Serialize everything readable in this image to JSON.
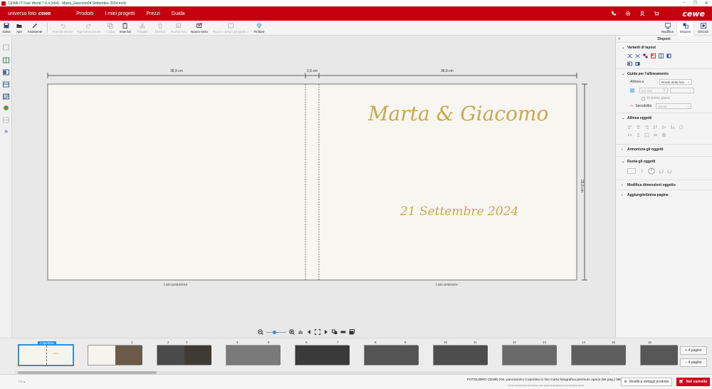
{
  "window": {
    "title": "CEWE FOTOWELT Foto World 7.4.4 (x64) - Marta_Giacomo04 Settembre 2024.mcfx",
    "title_display": "CEWE.IT Foto World 7.4.4 (x64) - Marta_Giacomo04 Settembre 2024.mcfx"
  },
  "menubar": {
    "brand_prefix": "universo foto",
    "brand_name": "cewe",
    "nav": [
      "Prodotti",
      "I miei progetti",
      "Prezzi",
      "Guida"
    ],
    "logo": "cewe"
  },
  "toolbar": {
    "items": [
      {
        "label": "Salva",
        "icon": "save-icon",
        "enabled": true
      },
      {
        "label": "Apri",
        "icon": "open-folder-icon",
        "enabled": true
      },
      {
        "label": "Assistente",
        "icon": "magic-wand-icon",
        "enabled": true
      },
      {
        "label": "Annulla azione",
        "icon": "undo-icon",
        "enabled": false
      },
      {
        "label": "Ripristina azione",
        "icon": "redo-icon",
        "enabled": false
      },
      {
        "label": "Copia",
        "icon": "copy-icon",
        "enabled": false
      },
      {
        "label": "Inserisci",
        "icon": "paste-icon",
        "enabled": true
      },
      {
        "label": "Ritaglia",
        "icon": "cut-icon",
        "enabled": false
      },
      {
        "label": "Elimina",
        "icon": "trash-icon",
        "enabled": false
      },
      {
        "label": "Nuova foto",
        "icon": "add-photo-icon",
        "enabled": false
      },
      {
        "label": "Nuovo testo",
        "icon": "add-text-icon",
        "enabled": true
      },
      {
        "label": "Nuovo campo geografico",
        "icon": "map-icon",
        "enabled": false
      },
      {
        "label": "Finiture",
        "icon": "diamond-icon",
        "enabled": true
      }
    ],
    "right": [
      {
        "label": "Modifica",
        "icon": "edit-icon"
      },
      {
        "label": "Disponi",
        "icon": "arrange-icon",
        "active": true
      },
      {
        "label": "Decora",
        "icon": "decorate-icon"
      }
    ]
  },
  "canvas": {
    "dim_back": "38,9 cm",
    "dim_spine": "2,0 cm",
    "dim_front": "38,9 cm",
    "dim_height": "29,6 cm",
    "names": "Marta & Giacomo",
    "date": "21 Settembre 2024",
    "label_back": "Lato posteriore",
    "label_front": "Lato anteriore",
    "gold": "#c9a84c"
  },
  "panel": {
    "title": "Disponi",
    "layout_variants": "Varianti di layout",
    "alignment_guide": "Guida per l'allineamento",
    "align_to_label": "Allinea a",
    "align_to_value": "Bordo della foto",
    "distance_value": "5,0 mm",
    "foreground_label": "In primo piano",
    "sensitivity_label": "Sensibilità",
    "sensitivity_value": "bassa",
    "align_objects": "Allinea oggetti",
    "harmonize": "Armonizza gli oggetti",
    "rotate": "Ruota gli oggetti",
    "resize": "Modifica dimensioni oggetto",
    "add_remove_pages": "Aggiungi/elimina pagine"
  },
  "strip": {
    "cover_tag": "Copertina",
    "page_numbers": [
      "1",
      "2",
      "3",
      "4",
      "5",
      "6",
      "7",
      "8",
      "9",
      "10",
      "11",
      "12",
      "13",
      "14",
      "15",
      "16"
    ],
    "add_pages": "+ 4 pagine",
    "remove_pages": "− 4 pagine"
  },
  "status": {
    "product": "FOTOLIBRO CEWE XXL panoramico Copertina in lino Carta fotografica premium opaca (56 pag.) 390,45 €*",
    "note": "* prezzo al listino/ora IVA inclusa, escl. spese di spedizione come da listino prezzi",
    "details_button": "Modifica dettagli prodotto",
    "cart_button": "Nel carrello"
  }
}
